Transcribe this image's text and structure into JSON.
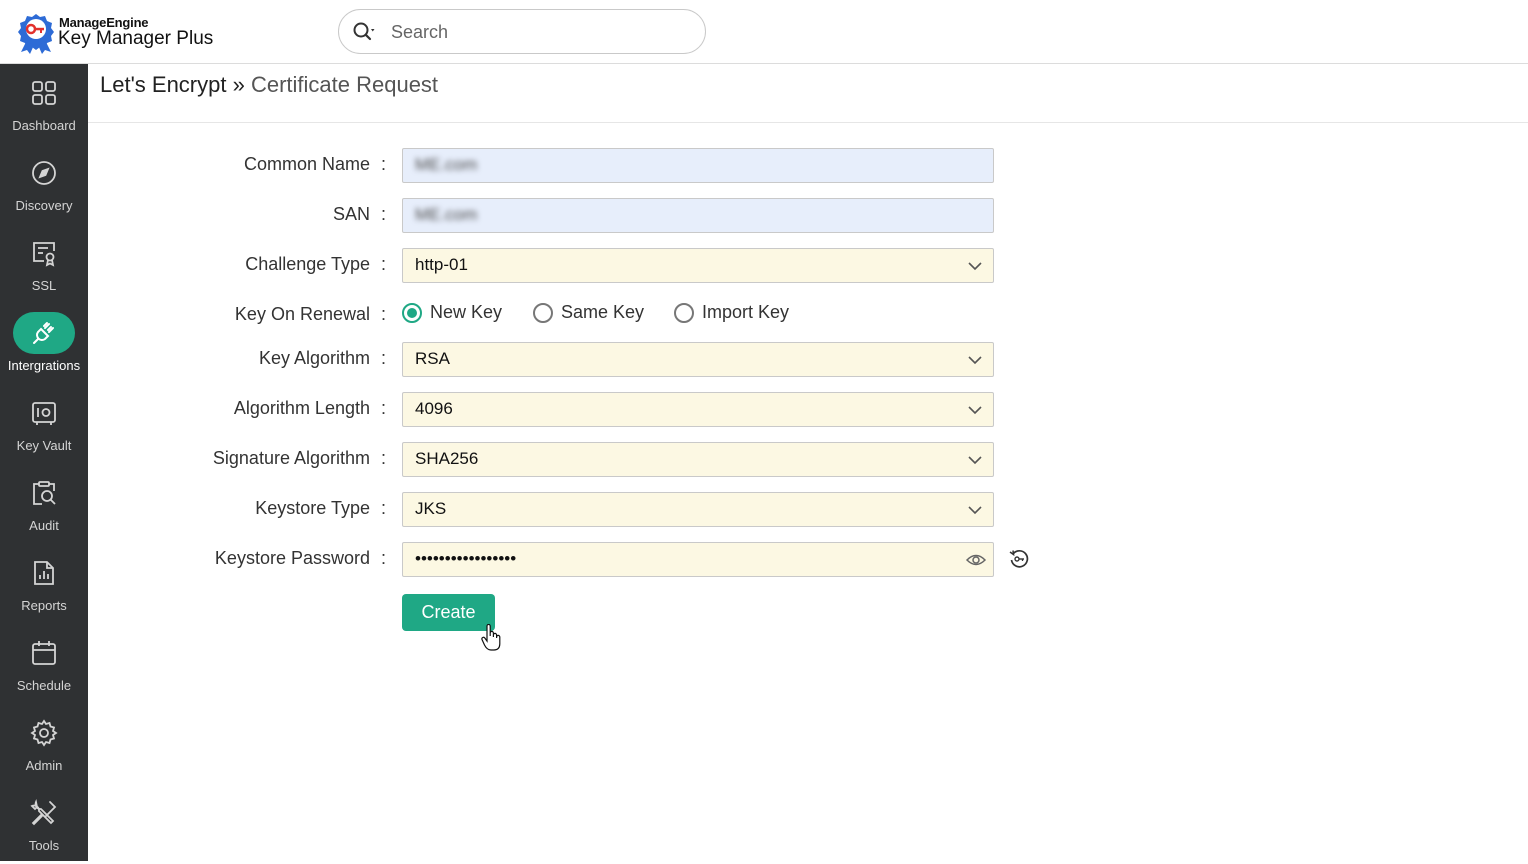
{
  "header": {
    "brand": "ManageEngine",
    "product_bold": "Key Manager",
    "product_thin": " Plus",
    "search_placeholder": "Search",
    "logo_icon": "key-ribbon-logo",
    "search_icon": "search-icon"
  },
  "sidebar": {
    "active_color": "#1fa885",
    "items": [
      {
        "label": "Dashboard",
        "icon": "dashboard-icon"
      },
      {
        "label": "Discovery",
        "icon": "compass-icon"
      },
      {
        "label": "SSL",
        "icon": "certificate-icon"
      },
      {
        "label": "Intergrations",
        "icon": "plug-icon",
        "active": true
      },
      {
        "label": "Key Vault",
        "icon": "vault-icon"
      },
      {
        "label": "Audit",
        "icon": "audit-icon"
      },
      {
        "label": "Reports",
        "icon": "reports-icon"
      },
      {
        "label": "Schedule",
        "icon": "calendar-icon"
      },
      {
        "label": "Admin",
        "icon": "gear-icon"
      },
      {
        "label": "Tools",
        "icon": "tools-icon"
      }
    ]
  },
  "page": {
    "title_main": "Let's Encrypt",
    "title_sep": " » ",
    "title_sub": "Certificate Request"
  },
  "form": {
    "colon": ":",
    "common_name": {
      "label": "Common Name",
      "value": "ME.com"
    },
    "san": {
      "label": "SAN",
      "value": "ME.com"
    },
    "challenge_type": {
      "label": "Challenge Type",
      "value": "http-01"
    },
    "key_on_renewal": {
      "label": "Key On Renewal",
      "options": [
        "New Key",
        "Same Key",
        "Import Key"
      ],
      "selected": "New Key"
    },
    "key_algorithm": {
      "label": "Key Algorithm",
      "value": "RSA"
    },
    "algorithm_length": {
      "label": "Algorithm Length",
      "value": "4096"
    },
    "signature_algorithm": {
      "label": "Signature Algorithm",
      "value": "SHA256"
    },
    "keystore_type": {
      "label": "Keystore Type",
      "value": "JKS"
    },
    "keystore_password": {
      "label": "Keystore Password",
      "value": "•••••••••••••••••"
    },
    "create_label": "Create"
  }
}
